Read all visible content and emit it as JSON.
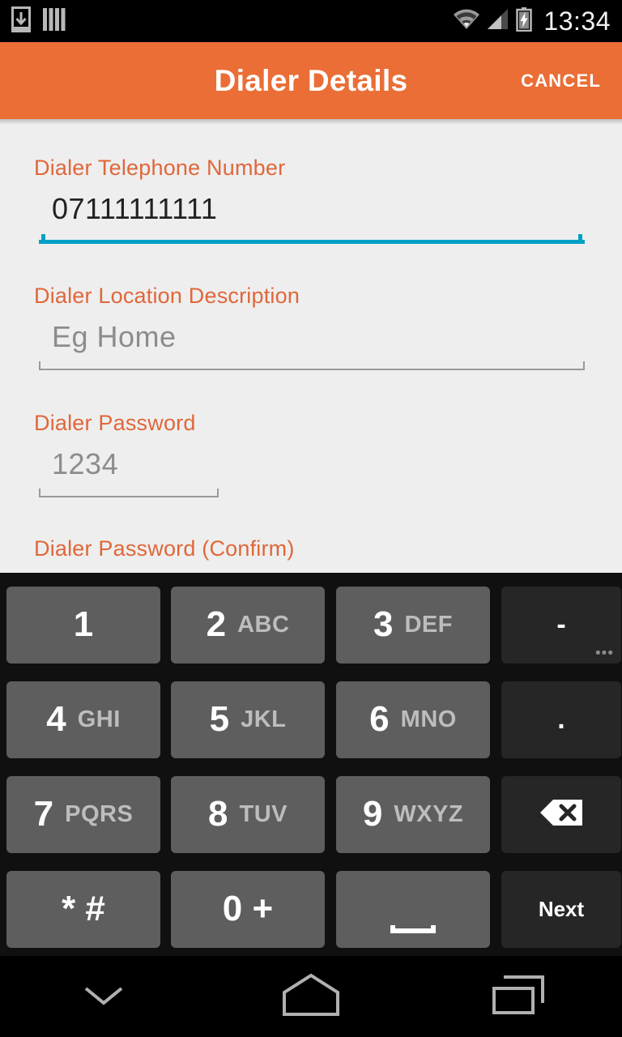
{
  "status_bar": {
    "icons_left": [
      "download-icon",
      "sim-bars-icon"
    ],
    "icons_right": [
      "wifi-icon",
      "signal-icon",
      "battery-charging-icon"
    ],
    "clock": "13:34"
  },
  "action_bar": {
    "title": "Dialer Details",
    "cancel_label": "CANCEL",
    "background_color": "#ea6e36",
    "title_color": "#ffffff"
  },
  "form": {
    "background_color": "#eeeeee",
    "label_color": "#e0673a",
    "focused_underline_color": "#00a0c6",
    "fields": [
      {
        "label": "Dialer Telephone Number",
        "value": "07111111111",
        "placeholder": "",
        "is_placeholder": false,
        "focused": true
      },
      {
        "label": "Dialer Location Description",
        "value": "",
        "placeholder": "Eg Home",
        "is_placeholder": true,
        "focused": false
      },
      {
        "label": "Dialer Password",
        "value": "",
        "placeholder": "1234",
        "is_placeholder": true,
        "focused": false
      },
      {
        "label": "Dialer Password (Confirm)",
        "value": "",
        "placeholder": "",
        "is_placeholder": true,
        "focused": false
      }
    ]
  },
  "keyboard": {
    "type": "phone-numeric",
    "background_color": "#101010",
    "key_light_color": "#5e5e5e",
    "key_dark_color": "#262626",
    "rows": [
      [
        {
          "digit": "1",
          "letters": "",
          "kind": "light",
          "name": "key-1"
        },
        {
          "digit": "2",
          "letters": "ABC",
          "kind": "light",
          "name": "key-2"
        },
        {
          "digit": "3",
          "letters": "DEF",
          "kind": "light",
          "name": "key-3"
        },
        {
          "digit": "-",
          "letters": "",
          "kind": "dark",
          "name": "key-dash",
          "ellipsis": "•••"
        }
      ],
      [
        {
          "digit": "4",
          "letters": "GHI",
          "kind": "light",
          "name": "key-4"
        },
        {
          "digit": "5",
          "letters": "JKL",
          "kind": "light",
          "name": "key-5"
        },
        {
          "digit": "6",
          "letters": "MNO",
          "kind": "light",
          "name": "key-6"
        },
        {
          "digit": ".",
          "letters": "",
          "kind": "dark",
          "name": "key-period"
        }
      ],
      [
        {
          "digit": "7",
          "letters": "PQRS",
          "kind": "light",
          "name": "key-7"
        },
        {
          "digit": "8",
          "letters": "TUV",
          "kind": "light",
          "name": "key-8"
        },
        {
          "digit": "9",
          "letters": "WXYZ",
          "kind": "light",
          "name": "key-9"
        },
        {
          "digit": "",
          "letters": "",
          "kind": "dark",
          "name": "key-backspace",
          "icon": "backspace-icon"
        }
      ],
      [
        {
          "digit": "* #",
          "letters": "",
          "kind": "light",
          "name": "key-star-hash"
        },
        {
          "digit": "0 +",
          "letters": "",
          "kind": "light",
          "name": "key-0"
        },
        {
          "digit": "",
          "letters": "",
          "kind": "light",
          "name": "key-space",
          "icon": "space-icon"
        },
        {
          "digit": "",
          "letters": "",
          "kind": "dark",
          "name": "key-next",
          "label": "Next"
        }
      ]
    ]
  },
  "nav_bar": {
    "buttons": [
      {
        "name": "hide-keyboard-icon",
        "label": "Hide keyboard"
      },
      {
        "name": "home-icon",
        "label": "Home"
      },
      {
        "name": "recents-icon",
        "label": "Recents"
      }
    ]
  }
}
